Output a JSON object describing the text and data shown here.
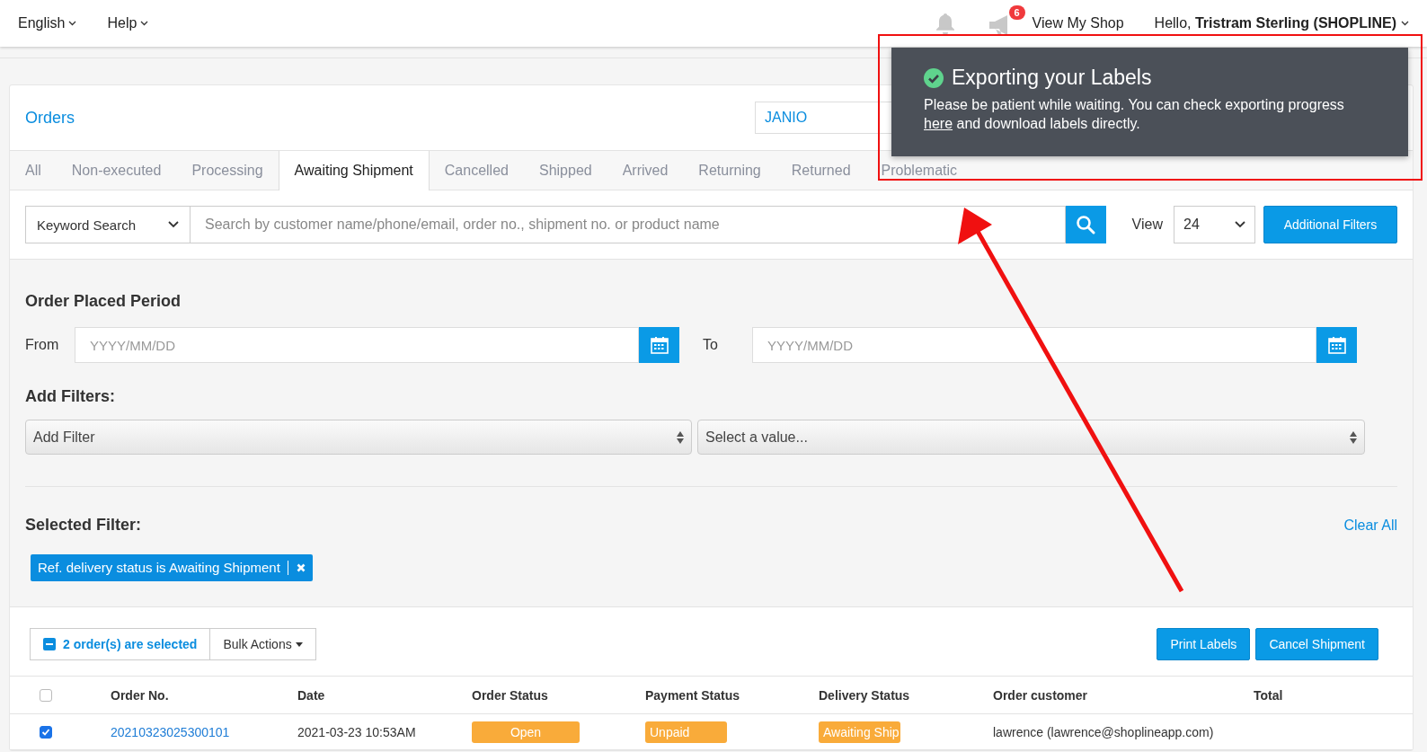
{
  "top_bar": {
    "menus": [
      {
        "label": "English"
      },
      {
        "label": "Help"
      }
    ],
    "announcement_badge": "6",
    "view_shop": "View My Shop",
    "greeting": "Hello, **Tristram Sterling (SHOPLINE)**"
  },
  "header": {
    "title": "Orders",
    "carrier_select": "JANIO"
  },
  "tabs": [
    {
      "label": "All",
      "selected": false
    },
    {
      "label": "Non-executed",
      "selected": false
    },
    {
      "label": "Processing",
      "selected": false
    },
    {
      "label": "Awaiting Shipment",
      "selected": true
    },
    {
      "label": "Cancelled",
      "selected": false
    },
    {
      "label": "Shipped",
      "selected": false
    },
    {
      "label": "Arrived",
      "selected": false
    },
    {
      "label": "Returning",
      "selected": false
    },
    {
      "label": "Returned",
      "selected": false
    },
    {
      "label": "Problematic",
      "selected": false
    }
  ],
  "search": {
    "type_select": "Keyword Search",
    "placeholder": "Search by customer name/phone/email, order no., shipment no. or product name",
    "view_label": "View",
    "per_page": "24",
    "filters_button": "Additional Filters"
  },
  "period": {
    "title": "Order Placed Period",
    "from_label": "From",
    "from_placeholder": "YYYY/MM/DD",
    "to_label": "To",
    "to_placeholder": "YYYY/MM/DD"
  },
  "add_filters": {
    "title": "Add Filters:",
    "filter_placeholder": "Add Filter",
    "value_placeholder": "Select a value..."
  },
  "selected_filter": {
    "title": "Selected Filter:",
    "clear": "Clear All",
    "tags": [
      "Ref. delivery status is Awaiting Shipment"
    ]
  },
  "actions": {
    "selection": "2 order(s) are selected",
    "bulk": "Bulk Actions",
    "buttons": [
      "Print Labels",
      "Cancel Shipment"
    ]
  },
  "table": {
    "all_checked": false,
    "columns": [
      "Order No.",
      "Date",
      "Order Status",
      "Payment Status",
      "Delivery Status",
      "Order customer",
      "Total"
    ],
    "rows": [
      {
        "checked": true,
        "order_no": "20210323025300101",
        "date": "2021-03-23 10:53AM",
        "order_status": "Open",
        "payment_status": "Unpaid",
        "delivery_status": "Awaiting Ship",
        "customer": "lawrence (lawrence@shoplineapp.com)"
      }
    ]
  },
  "toast": {
    "title": "Exporting your Labels",
    "message_start": "Please be patient while waiting. You can check exporting progress",
    "link": "here",
    "message_end": "and download labels directly."
  }
}
